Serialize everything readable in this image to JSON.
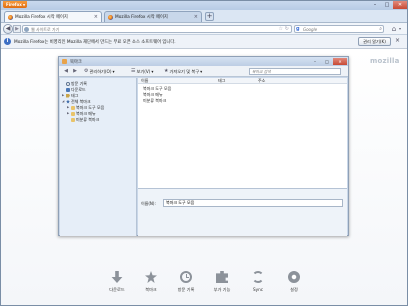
{
  "firefox_button": "Firefox",
  "tabs": [
    {
      "label": "Mozilla Firefox 시작 페이지"
    },
    {
      "label": "Mozilla Firefox 시작 페이지"
    }
  ],
  "navbar": {
    "url_placeholder": "웹 사이트로 가기",
    "search_placeholder": "Google"
  },
  "notification": {
    "message": "Mozilla Firefox는 비영리인 Mozilla 재단에서 만드는 무료 오픈 소스 소프트웨어 입니다.",
    "button": "권리 알기(K)"
  },
  "page": {
    "brand": "mozilla"
  },
  "library": {
    "title": "북마크",
    "toolbar": {
      "organize": "관리하기(O)",
      "views": "보기(V)",
      "import_backup": "가져오기 및 복구",
      "search_placeholder": "북마크 검색"
    },
    "tree": [
      "방문 기록",
      "다운로드",
      "태그",
      "전체 북마크",
      "북마크 도구 모음",
      "북마크 메뉴",
      "미분류 북마크"
    ],
    "columns": [
      "이름",
      "태그",
      "주소"
    ],
    "items": [
      "북마크 도구 모음",
      "북마크 메뉴",
      "미분류 북마크"
    ],
    "details": {
      "name_label": "이름(N):",
      "name_value": "북마크 도구 모음"
    }
  },
  "launcher": [
    {
      "label": "다운로드",
      "icon": "download-icon"
    },
    {
      "label": "북마크",
      "icon": "bookmark-star-icon"
    },
    {
      "label": "방문 기록",
      "icon": "history-clock-icon"
    },
    {
      "label": "부가 기능",
      "icon": "addons-puzzle-icon"
    },
    {
      "label": "Sync",
      "icon": "sync-icon"
    },
    {
      "label": "설정",
      "icon": "settings-gear-icon"
    }
  ]
}
